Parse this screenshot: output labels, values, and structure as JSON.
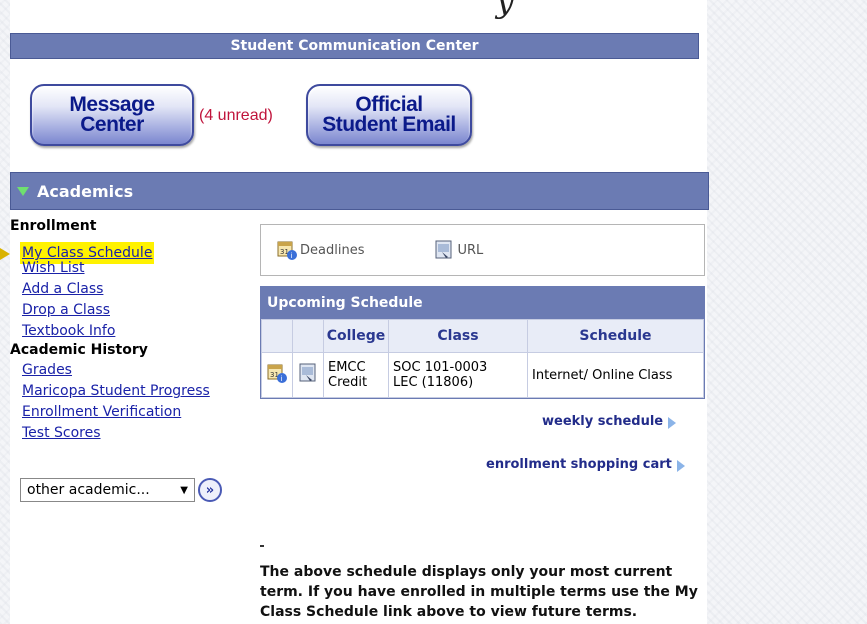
{
  "page_title_fragment": "y",
  "communication": {
    "header": "Student Communication Center",
    "message_button": {
      "line1": "Message",
      "line2": "Center"
    },
    "unread": "(4 unread)",
    "email_button": {
      "line1": "Official",
      "line2": "Student Email"
    }
  },
  "academics": {
    "header": "Academics",
    "enrollment_heading": "Enrollment",
    "enrollment_links": [
      "My Class Schedule",
      "Wish List",
      "Add a Class",
      "Drop a Class",
      "Textbook Info"
    ],
    "history_heading": "Academic History",
    "history_links": [
      "Grades",
      "Maricopa Student Progress",
      "Enrollment Verification",
      "Test Scores"
    ],
    "other_select": "other academic...",
    "deadlines_label": "Deadlines",
    "url_label": "URL"
  },
  "schedule": {
    "header": "Upcoming Schedule",
    "columns": [
      "College",
      "Class",
      "Schedule"
    ],
    "rows": [
      {
        "college_line1": "EMCC",
        "college_line2": "Credit",
        "class_line1": "SOC 101-0003",
        "class_line2": "LEC (11806)",
        "schedule": "Internet/ Online Class"
      }
    ],
    "weekly_link": "weekly schedule",
    "cart_link": "enrollment shopping cart"
  },
  "note": "The above schedule displays only your most current term.  If you have enrolled in multiple terms use the My Class Schedule link above to view future terms.",
  "colors": {
    "bar": "#6b7bb3",
    "link": "#1a22a8",
    "highlight": "#fff200",
    "unread": "#c0143c"
  }
}
